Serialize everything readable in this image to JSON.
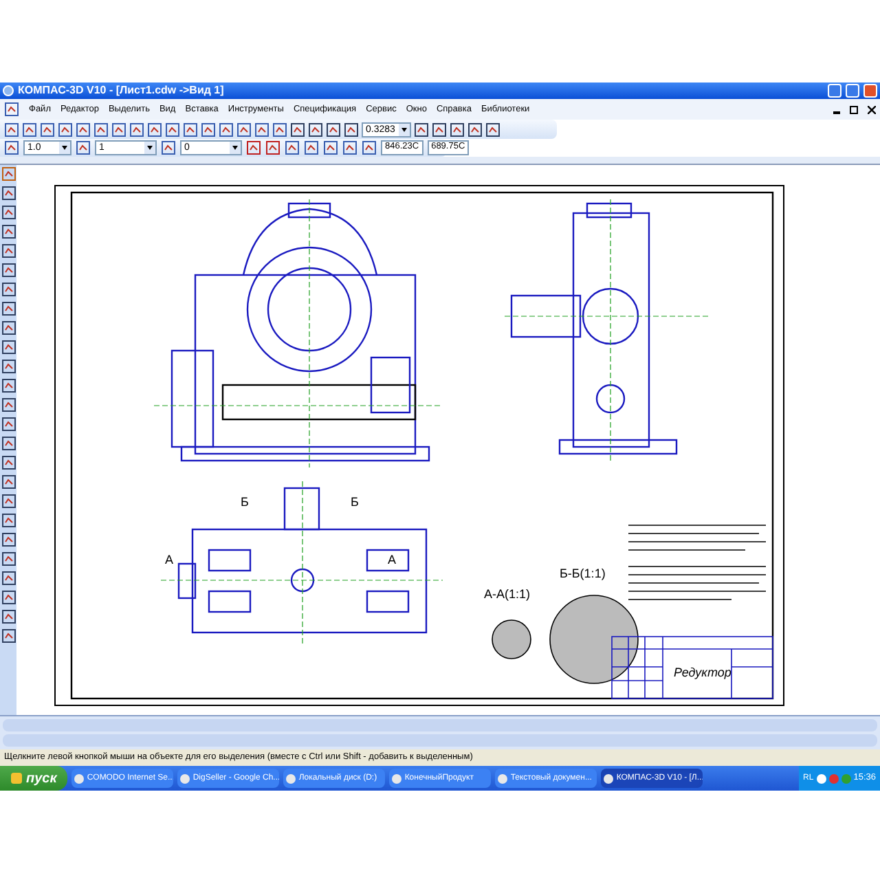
{
  "window": {
    "title": "КОМПАС-3D V10 - [Лист1.cdw ->Вид 1]"
  },
  "menu": [
    "Файл",
    "Редактор",
    "Выделить",
    "Вид",
    "Вставка",
    "Инструменты",
    "Спецификация",
    "Сервис",
    "Окно",
    "Справка",
    "Библиотеки"
  ],
  "toolbar": {
    "zoom_value": "0.3283",
    "line_style_value": "1.0",
    "layer_value": "1",
    "view_value": "0",
    "coord_x": "846.23C",
    "coord_y": "689.75C"
  },
  "drawing": {
    "title_block_name": "Редуктор",
    "section_a": "А-А(1:1)",
    "section_b": "Б-Б(1:1)",
    "view_marks": [
      "Б",
      "Б",
      "А",
      "А"
    ]
  },
  "status_bar": "Щелкните левой кнопкой мыши на объекте для его выделения (вместе с Ctrl или Shift - добавить к выделенным)",
  "taskbar": {
    "start": "пуск",
    "items": [
      {
        "label": "COMODO Internet Se...",
        "selected": false
      },
      {
        "label": "DigSeller - Google Ch...",
        "selected": false
      },
      {
        "label": "Локальный диск (D:)",
        "selected": false
      },
      {
        "label": "КонечныйПродукт",
        "selected": false
      },
      {
        "label": "Текстовый докумен...",
        "selected": false
      },
      {
        "label": "КОМПАС-3D V10 - [Л...",
        "selected": true
      }
    ],
    "language": "RL",
    "clock": "15:36"
  }
}
